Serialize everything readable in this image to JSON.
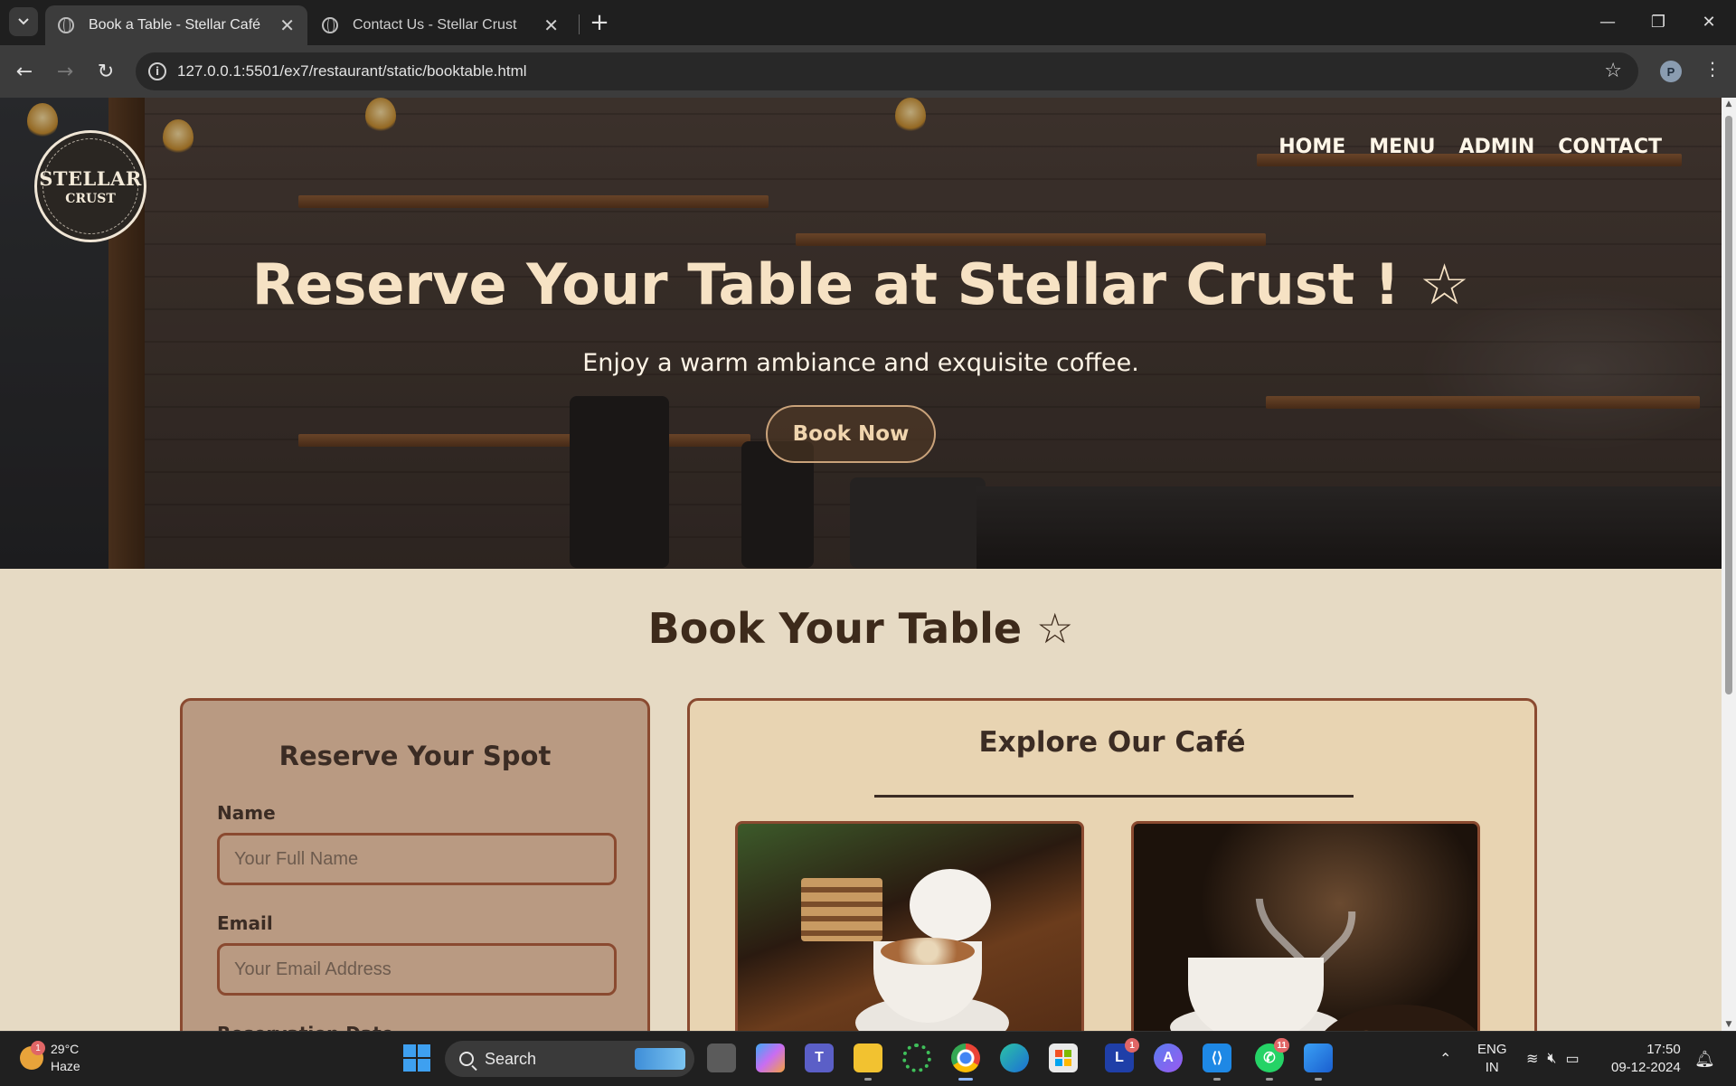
{
  "browser": {
    "tabs": [
      {
        "title": "Book a Table - Stellar Café",
        "active": true
      },
      {
        "title": "Contact Us - Stellar Crust",
        "active": false
      }
    ],
    "url": "127.0.0.1:5501/ex7/restaurant/static/booktable.html",
    "profile_initial": "P"
  },
  "site": {
    "logo": {
      "line1": "STELLAR",
      "line2": "CRUST"
    },
    "nav": [
      "HOME",
      "MENU",
      "ADMIN",
      "CONTACT"
    ],
    "hero": {
      "title": "Reserve Your Table at Stellar Crust ! ☆",
      "subtitle": "Enjoy a warm ambiance and exquisite coffee.",
      "cta": "Book Now"
    },
    "section_title": "Book Your Table ☆",
    "form": {
      "heading": "Reserve Your Spot",
      "name_label": "Name",
      "name_placeholder": "Your Full Name",
      "email_label": "Email",
      "email_placeholder": "Your Email Address",
      "date_label": "Reservation Date"
    },
    "explore": {
      "heading": "Explore Our Café"
    }
  },
  "taskbar": {
    "weather": {
      "temp": "29°C",
      "condition": "Haze",
      "badge": "1"
    },
    "search_label": "Search",
    "apps": [
      {
        "name": "task-view",
        "badge": ""
      },
      {
        "name": "copilot",
        "badge": ""
      },
      {
        "name": "teams",
        "badge": ""
      },
      {
        "name": "file-explorer",
        "badge": ""
      },
      {
        "name": "loader-app",
        "badge": ""
      },
      {
        "name": "chrome",
        "badge": ""
      },
      {
        "name": "edge",
        "badge": ""
      },
      {
        "name": "store",
        "badge": ""
      },
      {
        "name": "l-app",
        "badge": "1"
      },
      {
        "name": "arc-app",
        "badge": ""
      },
      {
        "name": "vscode",
        "badge": ""
      },
      {
        "name": "whatsapp",
        "badge": "11"
      },
      {
        "name": "photos",
        "badge": ""
      }
    ],
    "lang": {
      "line1": "ENG",
      "line2": "IN"
    },
    "time": "17:50",
    "date": "09-12-2024"
  },
  "colors": {
    "page_bg": "#e6dac4",
    "form_bg": "#b99a82",
    "card_border": "#8a4a30",
    "heading_text": "#3d2a1b",
    "hero_title": "#f6e2c4"
  }
}
